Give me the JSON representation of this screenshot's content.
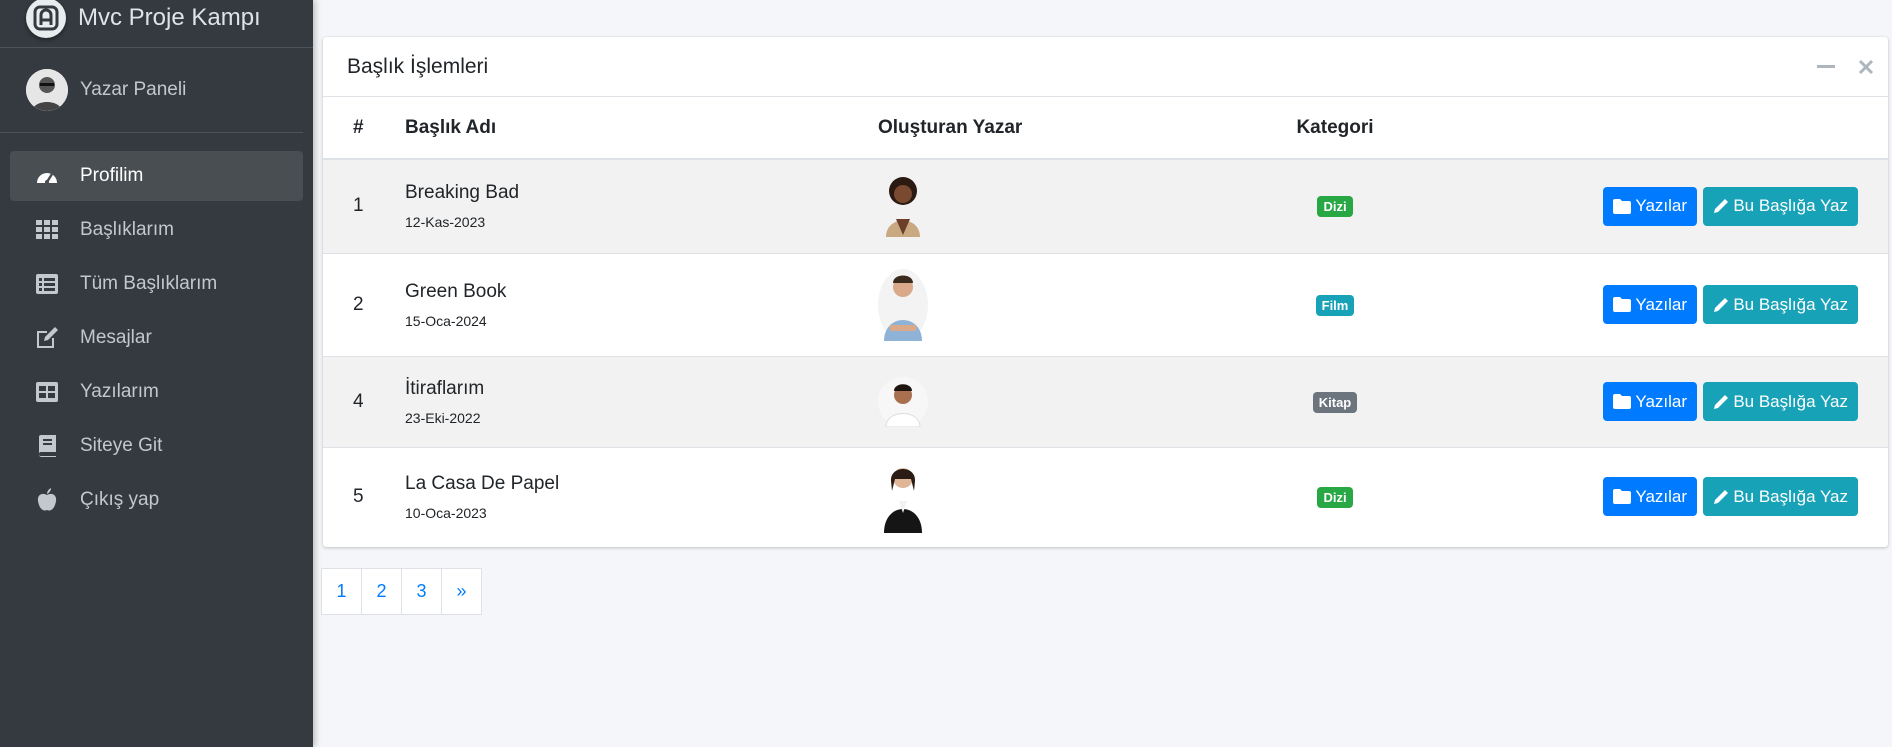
{
  "brand": {
    "title": "Mvc Proje Kampı"
  },
  "user": {
    "name": "Yazar Paneli"
  },
  "sidebar": {
    "items": [
      {
        "label": "Profilim",
        "icon": "dashboard-icon",
        "active": true
      },
      {
        "label": "Başlıklarım",
        "icon": "grid-icon"
      },
      {
        "label": "Tüm Başlıklarım",
        "icon": "list-icon"
      },
      {
        "label": "Mesajlar",
        "icon": "edit-icon"
      },
      {
        "label": "Yazılarım",
        "icon": "table-icon"
      },
      {
        "label": "Siteye Git",
        "icon": "book-icon"
      },
      {
        "label": "Çıkış yap",
        "icon": "apple-icon"
      }
    ]
  },
  "card": {
    "title": "Başlık İşlemleri",
    "columns": [
      "#",
      "Başlık Adı",
      "Oluşturan Yazar",
      "Kategori",
      ""
    ],
    "rows": [
      {
        "id": "1",
        "title": "Breaking Bad",
        "date": "12-Kas-2023",
        "category": "Dizi",
        "category_color": "#28a745"
      },
      {
        "id": "2",
        "title": "Green Book",
        "date": "15-Oca-2024",
        "category": "Film",
        "category_color": "#17a2b8"
      },
      {
        "id": "4",
        "title": "İtiraflarım",
        "date": "23-Eki-2022",
        "category": "Kitap",
        "category_color": "#6c757d"
      },
      {
        "id": "5",
        "title": "La Casa De Papel",
        "date": "10-Oca-2023",
        "category": "Dizi",
        "category_color": "#28a745"
      }
    ],
    "buttons": {
      "posts": "Yazılar",
      "write": "Bu Başlığa Yaz"
    }
  },
  "pagination": {
    "pages": [
      "1",
      "2",
      "3",
      "»"
    ]
  },
  "colors": {
    "sidebar": "#343a40",
    "primary": "#007bff",
    "info": "#17a2b8"
  }
}
